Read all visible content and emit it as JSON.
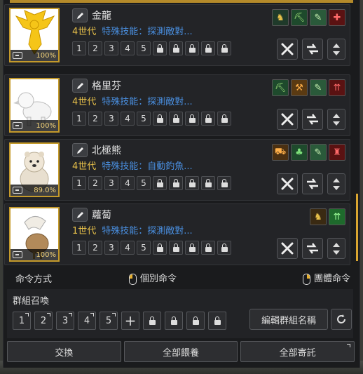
{
  "pets": [
    {
      "name": "金龍",
      "generation": "4世代",
      "skill": "特殊技能：探測敵對...",
      "hunger": "100%",
      "skill_icons": [
        {
          "icon": "horse-rider-icon",
          "bg": "#1f3a2a",
          "fg": "#e8c14a",
          "glyph": "♞"
        },
        {
          "icon": "pickaxe-icon",
          "bg": "#1e4a2c",
          "fg": "#9fe07a",
          "glyph": "⛏"
        },
        {
          "icon": "feather-icon",
          "bg": "#2a5a3a",
          "fg": "#c7f0b2",
          "glyph": "✎"
        },
        {
          "icon": "swords-icon",
          "bg": "#5a1212",
          "fg": "#ff6a6a",
          "glyph": "✚"
        }
      ]
    },
    {
      "name": "格里芬",
      "generation": "4世代",
      "skill": "特殊技能：探測敵對...",
      "hunger": "100%",
      "skill_icons": [
        {
          "icon": "pickaxe-icon",
          "bg": "#1e4a2c",
          "fg": "#9fe07a",
          "glyph": "⛏"
        },
        {
          "icon": "axe-icon",
          "bg": "#5a3a12",
          "fg": "#ffb04a",
          "glyph": "⚒"
        },
        {
          "icon": "feather-icon",
          "bg": "#2a5a3a",
          "fg": "#c7f0b2",
          "glyph": "✎"
        },
        {
          "icon": "arrows-up-icon",
          "bg": "#5a1212",
          "fg": "#ff6a6a",
          "glyph": "⇈"
        }
      ]
    },
    {
      "name": "北極熊",
      "generation": "4世代",
      "skill": "特殊技能：自動釣魚...",
      "hunger": "89.0%",
      "skill_icons": [
        {
          "icon": "cart-icon",
          "bg": "#4a3012",
          "fg": "#ffb04a",
          "glyph": "⛟"
        },
        {
          "icon": "clover-icon",
          "bg": "#1e4a2c",
          "fg": "#7ee07a",
          "glyph": "♣"
        },
        {
          "icon": "feather-icon",
          "bg": "#2a5a3a",
          "fg": "#c7f0b2",
          "glyph": "✎"
        },
        {
          "icon": "warrior-icon",
          "bg": "#5a1212",
          "fg": "#ff6a6a",
          "glyph": "♜"
        }
      ]
    },
    {
      "name": "蘿蔔",
      "generation": "1世代",
      "skill": "特殊技能：探測敵對...",
      "hunger": "100%",
      "skill_icons": [
        {
          "icon": "horse-rider-icon",
          "bg": "#3a2a12",
          "fg": "#e8c14a",
          "glyph": "♞"
        },
        {
          "icon": "arrows-up-icon",
          "bg": "#1e6a2c",
          "fg": "#9fff9a",
          "glyph": "⇈"
        }
      ]
    }
  ],
  "slot_numbers": [
    "1",
    "2",
    "3",
    "4",
    "5"
  ],
  "command": {
    "label": "命令方式",
    "individual": "個別命令",
    "group": "團體命令"
  },
  "group_summon": {
    "title": "群組召喚",
    "slots": [
      "1",
      "2",
      "3",
      "4",
      "5"
    ],
    "add": "+",
    "edit_name": "編輯群組名稱"
  },
  "bottom": {
    "exchange": "交換",
    "feed_all": "全部餵養",
    "deposit_all": "全部寄託"
  }
}
